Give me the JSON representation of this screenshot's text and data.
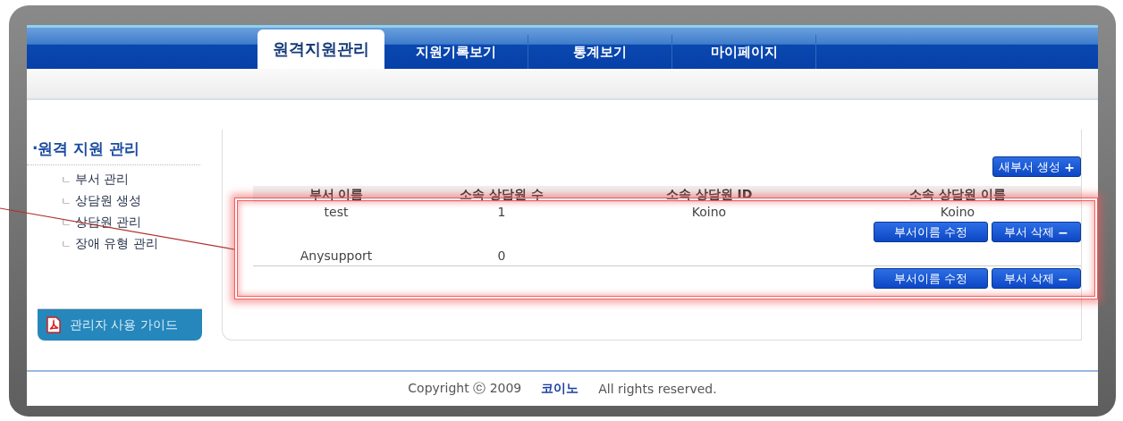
{
  "nav": {
    "tabs": [
      {
        "label": "원격지원관리",
        "selected": true
      },
      {
        "label": "지원기록보기",
        "selected": false
      },
      {
        "label": "통계보기",
        "selected": false
      },
      {
        "label": "마이페이지",
        "selected": false
      }
    ]
  },
  "sidebar": {
    "title": "·원격 지원 관리",
    "items": [
      {
        "marker": "ㄴ",
        "label": "부서 관리"
      },
      {
        "marker": "ㄴ",
        "label": "상담원 생성"
      },
      {
        "marker": "ㄴ",
        "label": "상담원 관리"
      },
      {
        "marker": "ㄴ",
        "label": "장애 유형 관리"
      }
    ],
    "guide_button": "관리자 사용 가이드"
  },
  "main": {
    "new_button": "새부서 생성",
    "new_button_symbol": "+",
    "table": {
      "columns": [
        "부서 이름",
        "소속 상담원 수",
        "소속 상담원 ID",
        "소속 상담원 이름"
      ],
      "rows": [
        {
          "cells": [
            "test",
            "1",
            "Koino",
            "Koino"
          ],
          "actions": [
            {
              "label": "부서이름 수정"
            },
            {
              "label": "부서 삭제",
              "symbol": "−"
            }
          ]
        },
        {
          "cells": [
            "Anysupport",
            "0"
          ],
          "actions": [
            {
              "label": "부서이름 수정"
            },
            {
              "label": "부서 삭제",
              "symbol": "−"
            }
          ]
        }
      ]
    }
  },
  "footer": {
    "copyright": "Copyright ⓒ 2009",
    "brand": "코이노",
    "rights": "All rights reserved."
  }
}
